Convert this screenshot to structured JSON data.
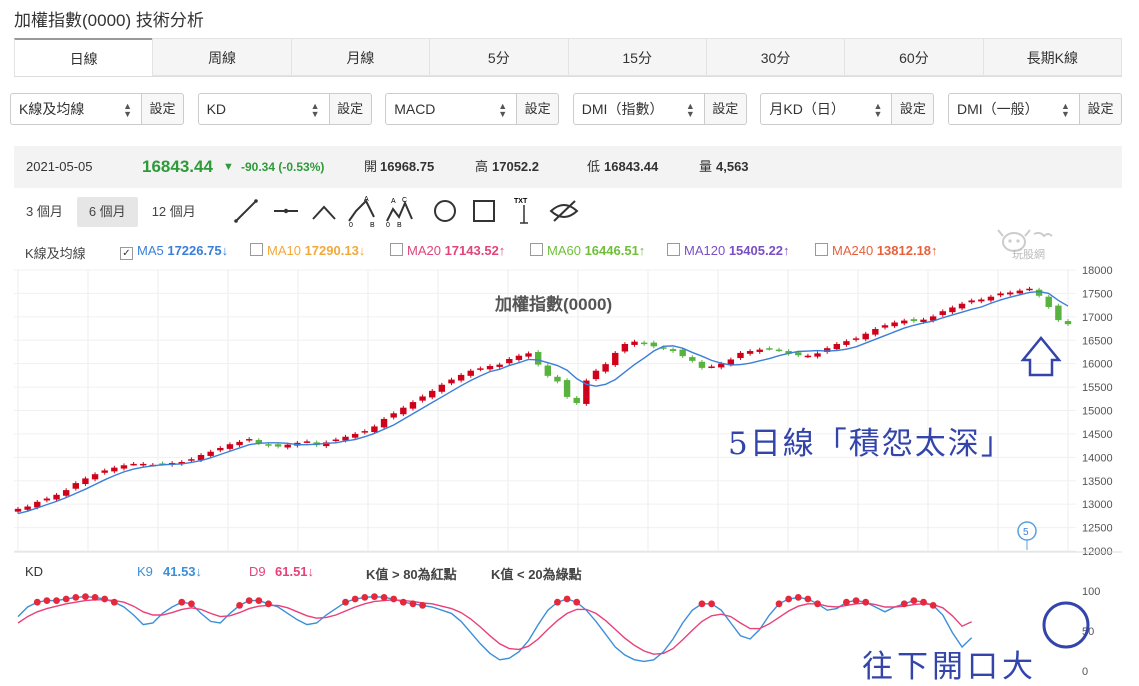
{
  "page_title": "加權指數(0000) 技術分析",
  "tabs": [
    "日線",
    "周線",
    "月線",
    "5分",
    "15分",
    "30分",
    "60分",
    "長期K線"
  ],
  "active_tab": 0,
  "selectors": [
    {
      "value": "K線及均線",
      "btn": "設定"
    },
    {
      "value": "KD",
      "btn": "設定"
    },
    {
      "value": "MACD",
      "btn": "設定"
    },
    {
      "value": "DMI（指數）",
      "btn": "設定"
    },
    {
      "value": "月KD（日）",
      "btn": "設定"
    },
    {
      "value": "DMI（一般）",
      "btn": "設定"
    }
  ],
  "quote": {
    "date": "2021-05-05",
    "price": "16843.44",
    "change": "-90.34 (-0.53%)",
    "open_label": "開",
    "open": "16968.75",
    "high_label": "高",
    "high": "17052.2",
    "low_label": "低",
    "low": "16843.44",
    "vol_label": "量",
    "vol": "4,563"
  },
  "ranges": [
    "3 個月",
    "6 個月",
    "12 個月"
  ],
  "active_range": 1,
  "tool_icons": [
    "line-tool-icon",
    "horizontal-line-tool-icon",
    "angle-tool-icon",
    "abc-pattern-icon",
    "abcd-pattern-icon",
    "circle-tool-icon",
    "rectangle-tool-icon",
    "text-tool-icon",
    "hide-drawings-icon"
  ],
  "ma_legend": {
    "label": "K線及均線",
    "items": [
      {
        "name": "MA5",
        "value": "17226.75↓",
        "color": "#3b7fd9",
        "checked": true
      },
      {
        "name": "MA10",
        "value": "17290.13↓",
        "color": "#f2a93b",
        "checked": false
      },
      {
        "name": "MA20",
        "value": "17143.52↑",
        "color": "#e0457b",
        "checked": false
      },
      {
        "name": "MA60",
        "value": "16446.51↑",
        "color": "#6fbf3a",
        "checked": false
      },
      {
        "name": "MA120",
        "value": "15405.22↑",
        "color": "#7a4fc4",
        "checked": false
      },
      {
        "name": "MA240",
        "value": "13812.18↑",
        "color": "#e8603c",
        "checked": false
      }
    ]
  },
  "watermark": "玩股網",
  "kd_legend": {
    "label": "KD",
    "k_name": "K9",
    "k_value": "41.53↓",
    "d_name": "D9",
    "d_value": "61.51↓",
    "note1": "K值 > 80為紅點",
    "note2": "K值 < 20為綠點"
  },
  "annotations": {
    "ma_note": "5日線「積怨太深」",
    "kd_note": "往下開口大",
    "marker": "5"
  },
  "colors": {
    "up": "#d0021b",
    "down": "#58b33e",
    "ma5": "#3b7fd9",
    "k": "#3b8fd9",
    "d": "#e8407a",
    "dot": "#e6283c",
    "annot": "#3344aa"
  },
  "chart_data": [
    {
      "type": "candlestick",
      "title": "加權指數(0000)",
      "ylim": [
        12000,
        18000
      ],
      "yticks": [
        12000,
        12500,
        13000,
        13500,
        14000,
        14500,
        15000,
        15500,
        16000,
        16500,
        17000,
        17500,
        18000
      ],
      "close": [
        12900,
        12950,
        13050,
        13120,
        13200,
        13300,
        13450,
        13550,
        13640,
        13720,
        13780,
        13830,
        13860,
        13860,
        13840,
        13860,
        13880,
        13900,
        13960,
        14050,
        14120,
        14200,
        14280,
        14330,
        14390,
        14300,
        14250,
        14230,
        14270,
        14310,
        14340,
        14260,
        14320,
        14380,
        14440,
        14500,
        14560,
        14660,
        14820,
        14940,
        15060,
        15180,
        15300,
        15420,
        15550,
        15660,
        15760,
        15850,
        15900,
        15950,
        15980,
        16100,
        16170,
        16220,
        15980,
        15740,
        15620,
        15290,
        15160,
        15640,
        15850,
        15990,
        16230,
        16420,
        16470,
        16420,
        16370,
        16330,
        16270,
        16160,
        16060,
        15910,
        15940,
        16000,
        16090,
        16230,
        16270,
        16300,
        16320,
        16290,
        16210,
        16180,
        16170,
        16220,
        16330,
        16420,
        16480,
        16540,
        16640,
        16740,
        16820,
        16880,
        16920,
        16910,
        16940,
        17010,
        17120,
        17200,
        17280,
        17350,
        17370,
        17430,
        17500,
        17520,
        17560,
        17600,
        17450,
        17210,
        16930,
        16843
      ],
      "ma5": [
        12800,
        12850,
        12920,
        12990,
        13060,
        13140,
        13230,
        13320,
        13420,
        13520,
        13610,
        13690,
        13750,
        13790,
        13820,
        13840,
        13850,
        13860,
        13890,
        13930,
        13990,
        14060,
        14130,
        14200,
        14270,
        14300,
        14310,
        14310,
        14300,
        14270,
        14270,
        14280,
        14300,
        14310,
        14350,
        14380,
        14440,
        14510,
        14600,
        14690,
        14810,
        14930,
        15050,
        15170,
        15290,
        15410,
        15530,
        15640,
        15740,
        15830,
        15880,
        15960,
        16020,
        16090,
        16080,
        16020,
        15960,
        15860,
        15680,
        15560,
        15520,
        15560,
        15660,
        15820,
        15980,
        16120,
        16270,
        16370,
        16380,
        16330,
        16240,
        16160,
        16070,
        16010,
        15970,
        15980,
        16010,
        16060,
        16110,
        16170,
        16220,
        16260,
        16270,
        16280,
        16270,
        16280,
        16310,
        16360,
        16440,
        16520,
        16600,
        16680,
        16760,
        16820,
        16870,
        16910,
        16980,
        17040,
        17100,
        17160,
        17210,
        17290,
        17360,
        17420,
        17470,
        17520,
        17540,
        17500,
        17350,
        17230
      ],
      "kd_k": [
        68,
        80,
        86,
        88,
        88,
        90,
        92,
        93,
        92,
        90,
        86,
        80,
        70,
        58,
        60,
        72,
        80,
        86,
        84,
        72,
        62,
        60,
        72,
        82,
        88,
        88,
        84,
        80,
        72,
        64,
        58,
        60,
        70,
        78,
        86,
        90,
        92,
        93,
        92,
        90,
        86,
        84,
        82,
        80,
        76,
        72,
        62,
        48,
        34,
        22,
        14,
        16,
        24,
        38,
        58,
        76,
        86,
        90,
        86,
        76,
        62,
        46,
        30,
        20,
        14,
        12,
        14,
        24,
        40,
        60,
        76,
        84,
        84,
        76,
        60,
        44,
        40,
        52,
        70,
        84,
        90,
        92,
        90,
        84,
        76,
        78,
        86,
        88,
        86,
        80,
        74,
        80,
        84,
        88,
        86,
        82,
        70,
        48,
        30,
        41.53
      ],
      "kd_d": [
        60,
        68,
        74,
        78,
        81,
        84,
        86,
        88,
        89,
        89,
        88,
        86,
        81,
        74,
        70,
        70,
        73,
        77,
        79,
        77,
        72,
        68,
        69,
        73,
        78,
        81,
        82,
        82,
        79,
        74,
        69,
        66,
        67,
        70,
        75,
        80,
        84,
        87,
        88,
        89,
        88,
        87,
        85,
        84,
        81,
        78,
        73,
        65,
        55,
        44,
        34,
        28,
        27,
        31,
        40,
        52,
        63,
        72,
        77,
        77,
        72,
        63,
        52,
        41,
        32,
        25,
        21,
        22,
        28,
        39,
        51,
        62,
        69,
        71,
        68,
        60,
        53,
        53,
        59,
        67,
        75,
        81,
        84,
        84,
        81,
        80,
        82,
        84,
        85,
        83,
        80,
        80,
        81,
        83,
        84,
        83,
        79,
        69,
        56,
        61.51
      ]
    }
  ]
}
